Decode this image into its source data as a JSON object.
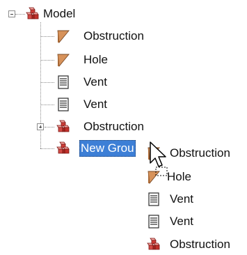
{
  "tree": {
    "root": {
      "label": "Model",
      "icon": "blocks-group-icon",
      "expanded": true
    },
    "children": [
      {
        "label": "Obstruction",
        "icon": "obstruction-wedge-icon"
      },
      {
        "label": "Hole",
        "icon": "hole-wedge-icon"
      },
      {
        "label": "Vent",
        "icon": "vent-document-icon"
      },
      {
        "label": "Vent",
        "icon": "vent-document-icon"
      },
      {
        "label": "Obstruction",
        "icon": "blocks-group-icon",
        "expanded": false
      },
      {
        "label": "New Grou",
        "icon": "blocks-group-icon",
        "selected": true
      }
    ]
  },
  "drag": {
    "items": [
      {
        "label": "Obstruction",
        "icon": "obstruction-wedge-icon"
      },
      {
        "label": "Hole",
        "icon": "hole-wedge-icon"
      },
      {
        "label": "Vent",
        "icon": "vent-document-icon"
      },
      {
        "label": "Vent",
        "icon": "vent-document-icon"
      },
      {
        "label": "Obstruction",
        "icon": "blocks-group-icon"
      }
    ]
  },
  "colors": {
    "selection": "#3d7fd6",
    "wedge": "#d7925a",
    "blocks": "#d24a45"
  }
}
